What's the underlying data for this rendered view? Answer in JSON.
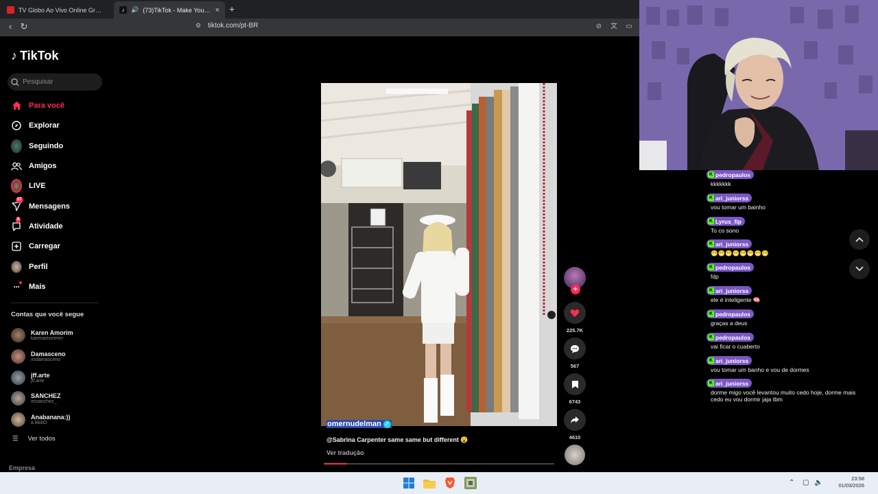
{
  "browser": {
    "tabs": [
      {
        "title": "TV Globo Ao Vivo Online Grátis | Ass"
      },
      {
        "title": "(73)TikTok - Make Your Day",
        "close": "×"
      }
    ],
    "new_tab": "+",
    "url": "tiktok.com/pt-BR"
  },
  "sidebar": {
    "logo": "TikTok",
    "search_placeholder": "Pesquisar",
    "nav": [
      {
        "label": "Para você",
        "icon": "home-icon"
      },
      {
        "label": "Explorar",
        "icon": "compass-icon"
      },
      {
        "label": "Seguindo",
        "icon": "following-avatar-icon"
      },
      {
        "label": "Amigos",
        "icon": "friends-icon"
      },
      {
        "label": "LIVE",
        "icon": "live-icon"
      },
      {
        "label": "Mensagens",
        "icon": "messages-icon",
        "badge": "57"
      },
      {
        "label": "Atividade",
        "icon": "activity-icon",
        "badge": "8"
      },
      {
        "label": "Carregar",
        "icon": "upload-icon"
      },
      {
        "label": "Perfil",
        "icon": "profile-avatar-icon"
      },
      {
        "label": "Mais",
        "icon": "more-icon"
      }
    ],
    "following_heading": "Contas que você segue",
    "accounts": [
      {
        "name": "Karen Amorim",
        "handle": "karenamorimm"
      },
      {
        "name": "Damasceno",
        "handle": "xsdamasceno"
      },
      {
        "name": "jff.arte",
        "handle": "jff.arte"
      },
      {
        "name": "SANCHEZ",
        "handle": "imsanchez_"
      },
      {
        "name": "Anabanana:))",
        "handle": "a.lkkkO"
      }
    ],
    "see_all": "Ver todos",
    "company": "Empresa"
  },
  "video": {
    "author": "omernudelman",
    "caption": "@Sabrina Carpenter same same but different 😮",
    "translate": "Ver tradução",
    "progress_fraction": 0.1,
    "likes": "225.7K",
    "comments": "567",
    "saves": "6743",
    "shares": "4610"
  },
  "chat": [
    {
      "user": "pedropaulos",
      "msg": "kkkkkkk"
    },
    {
      "user": "ari_juniorss",
      "msg": "vou tomar um bainho"
    },
    {
      "user": "Lyrus_fip",
      "msg": "To co sono"
    },
    {
      "user": "ari_juniorss",
      "msg": "😁😁😁😁😁😁😁😁"
    },
    {
      "user": "pedropaulos",
      "msg": "fdp"
    },
    {
      "user": "ari_juniorss",
      "msg": "ele é inteligente 🧠"
    },
    {
      "user": "pedropaulos",
      "msg": "graças a deus"
    },
    {
      "user": "pedropaulos",
      "msg": "vai ficar o cuaberto"
    },
    {
      "user": "ari_juniorss",
      "msg": "vou tomar um banho e vou de dormes"
    },
    {
      "user": "ari_juniorss",
      "msg": "dorme migo você levantou muito cedo hoje, dorme mais cedo eu vou dormir jaja tbm"
    }
  ],
  "taskbar": {
    "time": "23:58",
    "date": "01/03/2026"
  },
  "colors": {
    "accent": "#fe2c55",
    "kick_green": "#53fc18",
    "chat_user_bg": "#7b57c5"
  }
}
